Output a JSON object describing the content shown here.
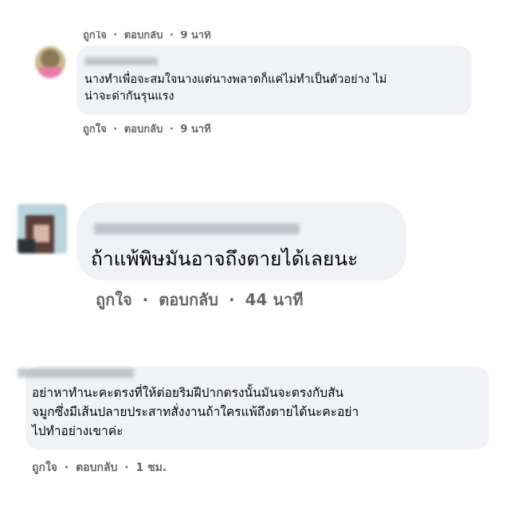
{
  "comments": [
    {
      "top_actions": {
        "like": "ถูกใจ",
        "dot": "·",
        "reply": "ตอบกลับ",
        "time": "9 นาที"
      }
    },
    {
      "text_line1": "นางทำเพื่อจะสมใจนางแต่นางพลาดก็แค่ไม่ทำเป็นตัวอย่าง ไม่",
      "text_line2": "น่าจะด่ากันรุนแรง",
      "actions": {
        "like": "ถูกใจ",
        "dot": "·",
        "reply": "ตอบกลับ",
        "time": "9 นาที"
      }
    },
    {
      "text": "ถ้าแพ้พิษมันอาจถึงตายได้เลยนะ",
      "actions": {
        "like": "ถูกใจ",
        "dot": "·",
        "reply": "ตอบกลับ",
        "time": "44 นาที"
      }
    },
    {
      "text_line1": "อย่าหาทำนะคะตรงที่ให้ต่อยริมฝีปากตรงนั้นมันจะตรงกับสัน",
      "text_line2": "จมูกซึ่งมีเส้นปลายประสาทสั่งงานถ้าใครแพ้ถึงตายได้นะคะอย่า",
      "text_line3": "ไปทำอย่างเขาค่ะ",
      "actions": {
        "like": "ถูกใจ",
        "dot": "·",
        "reply": "ตอบกลับ",
        "time": "1 ชม."
      }
    }
  ]
}
